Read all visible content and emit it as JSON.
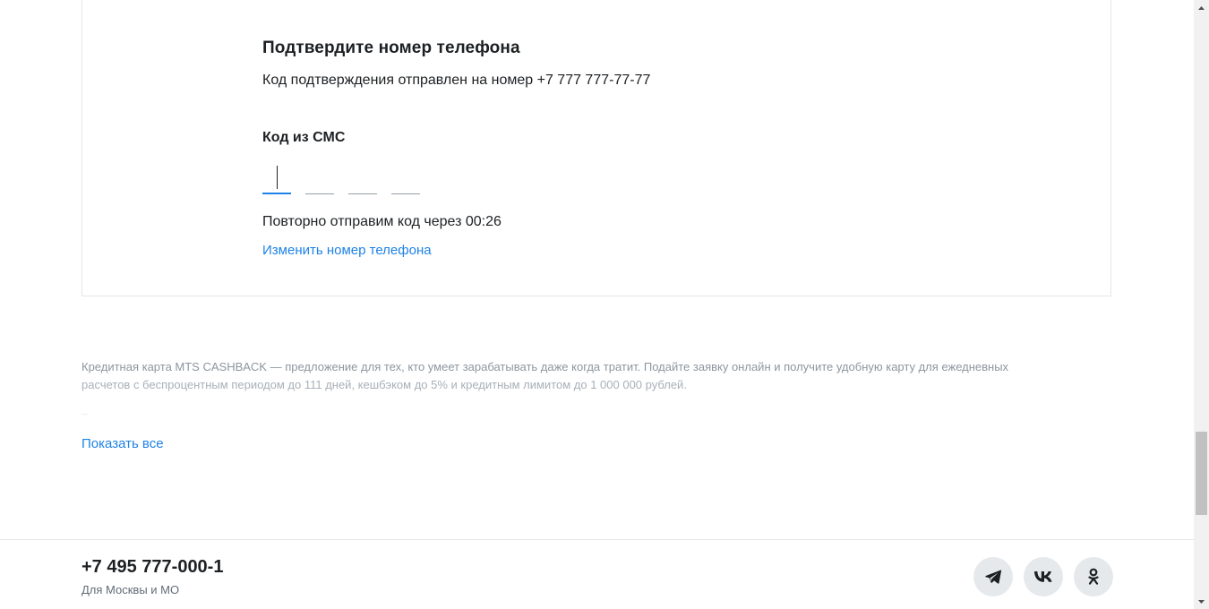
{
  "confirm": {
    "title": "Подтвердите номер телефона",
    "subtitle": "Код подтверждения отправлен на номер +7 777 777-77-77",
    "code_label": "Код из СМС",
    "code_digits": [
      "",
      "",
      "",
      ""
    ],
    "resend_text": "Повторно отправим код через 00:26",
    "change_phone_link": "Изменить номер телефона"
  },
  "description": {
    "line1": "Кредитная карта MTS CASHBACK — предложение для тех, кто умеет зарабатывать даже когда тратит. Подайте заявку онлайн и получите удобную карту для ежедневных",
    "line2": "расчетов с беспроцентным периодом до 111 дней, кешбэком до 5% и кредитным лимитом до 1 000 000 рублей.",
    "show_all_link": "Показать все"
  },
  "footer": {
    "phone": "+7 495 777-000-1",
    "region": "Для Москвы и МО",
    "socials": [
      {
        "icon": "telegram-icon"
      },
      {
        "icon": "vk-icon"
      },
      {
        "icon": "ok-icon"
      }
    ]
  },
  "colors": {
    "accent": "#1e82e6",
    "text": "#1d2023",
    "muted": "#8d969f",
    "social_bg": "#e6e9ec"
  }
}
